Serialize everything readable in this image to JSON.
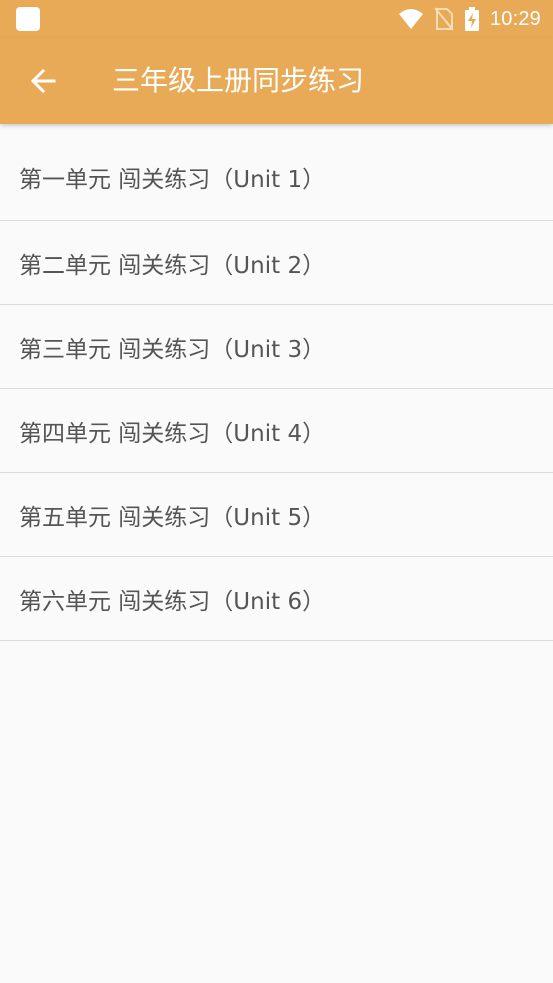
{
  "status_bar": {
    "time": "10:29",
    "icons": [
      "notification-icon",
      "wifi-icon",
      "no-sim-icon",
      "battery-charging-icon"
    ]
  },
  "app_bar": {
    "title": "三年级上册同步练习",
    "back_icon": "arrow-left-icon"
  },
  "units": [
    {
      "label": "第一单元 闯关练习（Unit 1）"
    },
    {
      "label": "第二单元 闯关练习（Unit 2）"
    },
    {
      "label": "第三单元 闯关练习（Unit 3）"
    },
    {
      "label": "第四单元 闯关练习（Unit 4）"
    },
    {
      "label": "第五单元 闯关练习（Unit 5）"
    },
    {
      "label": "第六单元 闯关练习（Unit 6）"
    }
  ],
  "colors": {
    "accent": "#e8aa57",
    "background": "#fafafa",
    "text": "#555555",
    "divider": "#dcdcdc"
  }
}
